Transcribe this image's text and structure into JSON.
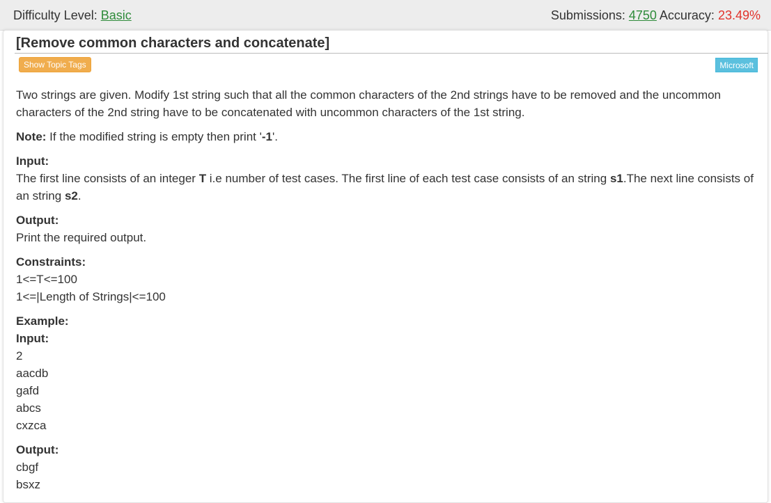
{
  "header": {
    "difficulty_label": "Difficulty Level: ",
    "difficulty_value": "Basic",
    "submissions_label": "Submissions: ",
    "submissions_value": "4750",
    "accuracy_label": " Accuracy: ",
    "accuracy_value": "23.49%"
  },
  "problem": {
    "title": "[Remove common characters and concatenate]",
    "show_tags_label": "Show Topic Tags",
    "company_tag": "Microsoft",
    "description": "Two strings are given. Modify 1st string such that all the common characters of the 2nd strings have to be removed and the uncommon characters of the 2nd string have to be concatenated with uncommon characters of the 1st string.",
    "note_label": "Note:",
    "note_text": " If the modified string is empty then print '",
    "note_value": "-1",
    "note_end": "'.",
    "input_heading": "Input:",
    "input_text_1": "The first line consists of an integer ",
    "input_T": "T",
    "input_text_2": " i.e number of test cases. The first line of each test case consists of an string ",
    "input_s1": "s1",
    "input_text_3": ".The next line consists of an string ",
    "input_s2": "s2",
    "input_text_4": ".",
    "output_heading": "Output:",
    "output_text": "Print the required output.",
    "constraints_heading": "Constraints:",
    "constraints": [
      "1<=T<=100",
      "1<=|Length of Strings|<=100"
    ],
    "example_heading": "Example:",
    "example_input_heading": "Input:",
    "example_input_lines": [
      "2",
      "aacdb",
      "gafd",
      "abcs",
      "cxzca"
    ],
    "example_output_heading": "Output:",
    "example_output_lines": [
      "cbgf",
      "bsxz"
    ]
  },
  "colors": {
    "link_green": "#2e8b3a",
    "accuracy_red": "#e2332b",
    "tags_button": "#f0ad4e",
    "company_badge": "#5bc0de"
  }
}
